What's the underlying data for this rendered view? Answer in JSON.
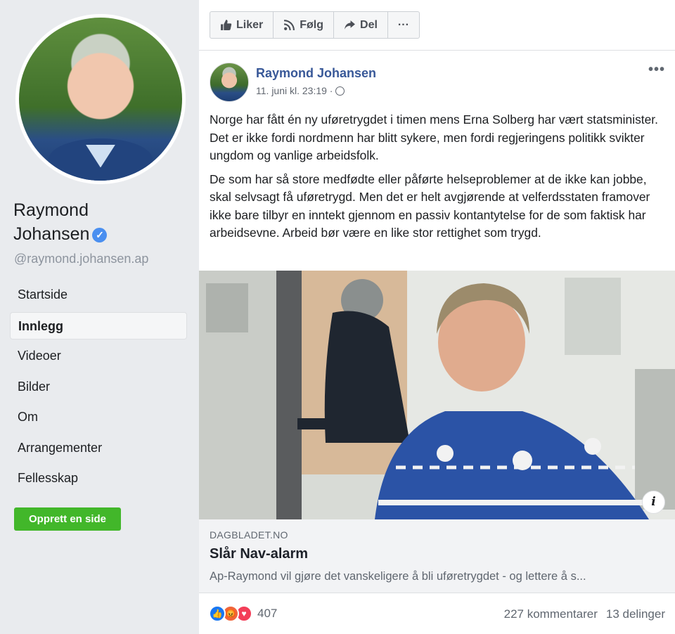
{
  "sidebar": {
    "name_line1": "Raymond",
    "name_line2": "Johansen",
    "verified_icon": "verified-checkmark-icon",
    "handle": "@raymond.johansen.ap",
    "nav": [
      {
        "label": "Startside",
        "active": false
      },
      {
        "label": "Innlegg",
        "active": true
      },
      {
        "label": "Videoer",
        "active": false
      },
      {
        "label": "Bilder",
        "active": false
      },
      {
        "label": "Om",
        "active": false
      },
      {
        "label": "Arrangementer",
        "active": false
      },
      {
        "label": "Fellesskap",
        "active": false
      }
    ],
    "create_button": "Opprett en side"
  },
  "actions": {
    "like": "Liker",
    "follow": "Følg",
    "share": "Del",
    "more": "···"
  },
  "post": {
    "author": "Raymond Johansen",
    "timestamp": "11. juni kl. 23:19 ·",
    "more": "•••",
    "paragraphs": [
      "Norge har fått én ny uføretrygdet i timen mens Erna Solberg har vært statsminister. Det er ikke fordi nordmenn har blitt sykere, men fordi regjeringens politikk svikter ungdom og vanlige arbeidsfolk.",
      "De som har så store medfødte eller påførte helseproblemer at de ikke kan jobbe, skal selvsagt få uføretrygd. Men det er helt avgjørende at velferdsstaten framover ikke bare tilbyr en inntekt gjennom en passiv kontantytelse for de som faktisk har arbeidsevne. Arbeid bør være en like stor rettighet som trygd."
    ],
    "link": {
      "domain": "DAGBLADET.NO",
      "title": "Slår Nav-alarm",
      "description": "Ap-Raymond vil gjøre det vanskeligere å bli uføretrygdet - og lettere å s...",
      "info": "i"
    },
    "reactions_count": "407",
    "comments": "227 kommentarer",
    "shares": "13 delinger"
  },
  "colors": {
    "link_blue": "#385898",
    "green_button": "#42b72a",
    "background": "#e9ebee"
  }
}
